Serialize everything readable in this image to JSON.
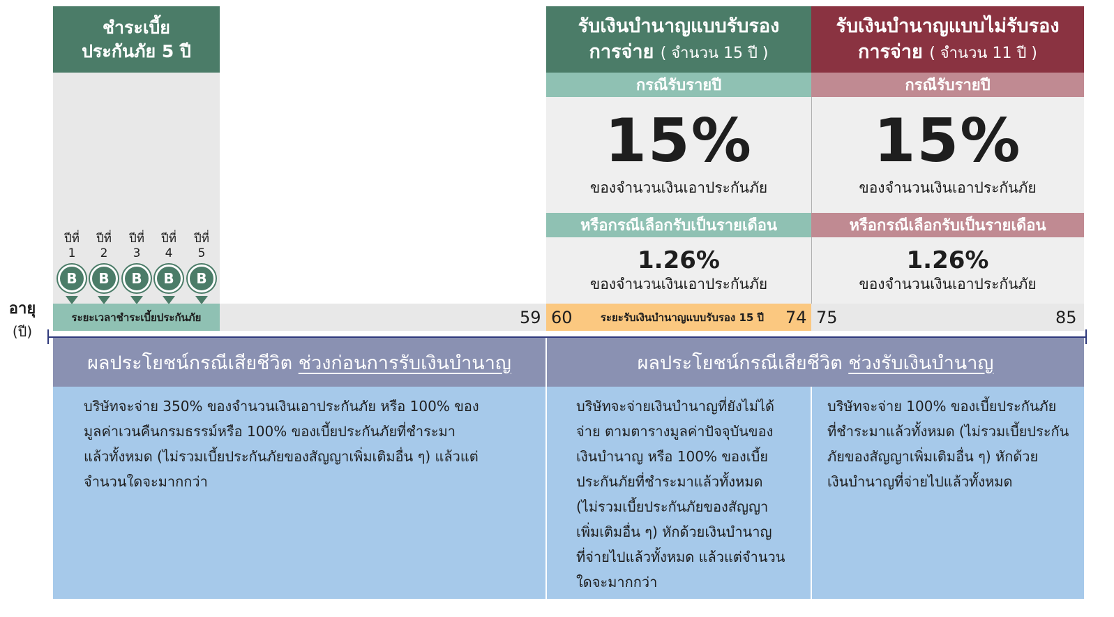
{
  "payment_header": {
    "line1": "ชำระเบี้ย",
    "line2": "ประกันภัย 5 ปี"
  },
  "certified_header": {
    "line1": "รับเงินบำนาญแบบรับรอง",
    "line2_main": "การจ่าย",
    "line2_sub": "( จำนวน 15 ปี )"
  },
  "uncertified_header": {
    "line1": "รับเงินบำนาญแบบไม่รับรอง",
    "line2_main": "การจ่าย",
    "line2_sub": "( จำนวน 11 ปี )"
  },
  "payment_years": [
    {
      "label_top": "ปีที่",
      "label_num": "1",
      "badge": "B"
    },
    {
      "label_top": "ปีที่",
      "label_num": "2",
      "badge": "B"
    },
    {
      "label_top": "ปีที่",
      "label_num": "3",
      "badge": "B"
    },
    {
      "label_top": "ปีที่",
      "label_num": "4",
      "badge": "B"
    },
    {
      "label_top": "ปีที่",
      "label_num": "5",
      "badge": "B"
    }
  ],
  "certified_panel": {
    "yearly_label": "กรณีรับรายปี",
    "yearly_pct": "15%",
    "yearly_note": "ของจำนวนเงินเอาประกันภัย",
    "monthly_label": "หรือกรณีเลือกรับเป็นรายเดือน",
    "monthly_pct": "1.26%",
    "monthly_note": "ของจำนวนเงินเอาประกันภัย"
  },
  "uncertified_panel": {
    "yearly_label": "กรณีรับรายปี",
    "yearly_pct": "15%",
    "yearly_note": "ของจำนวนเงินเอาประกันภัย",
    "monthly_label": "หรือกรณีเลือกรับเป็นรายเดือน",
    "monthly_pct": "1.26%",
    "monthly_note": "ของจำนวนเงินเอาประกันภัย"
  },
  "timeline": {
    "axis_label": "อายุ",
    "axis_unit": "(ปี)",
    "payment_period_label": "ระยะเวลาชำระเบี้ยประกันภัย",
    "certified_period_label": "ระยะรับเงินบำนาญแบบรับรอง 15 ปี",
    "ages": {
      "a59": "59",
      "a60": "60",
      "a74": "74",
      "a75": "75",
      "a85": "85"
    }
  },
  "colors": {
    "green_dark": "#4b7c68",
    "green_light": "#8fc1b3",
    "maroon": "#8a3341",
    "rose": "#c08a92",
    "orange": "#fbc880",
    "navy_line": "#2f3a7c",
    "slate_band": "#8a91b2",
    "blue_body": "#a6c9ea"
  },
  "bottom": {
    "left_title_plain": "ผลประโยชน์กรณีเสียชีวิต",
    "left_title_underlined": "ช่วงก่อนการรับเงินบำนาญ",
    "right_title_plain": "ผลประโยชน์กรณีเสียชีวิต",
    "right_title_underlined": "ช่วงรับเงินบำนาญ",
    "left_text": [
      "บริษัทจะจ่าย 350% ของจำนวนเงินเอาประกันภัย หรือ 100% ของ",
      "มูลค่าเวนคืนกรมธรรม์หรือ 100% ของเบี้ยประกันภัยที่ชำระมา",
      "แล้วทั้งหมด  (ไม่รวมเบี้ยประกันภัยของสัญญาเพิ่มเติมอื่น ๆ) แล้วแต่",
      "จำนวนใดจะมากกว่า"
    ],
    "middle_text": [
      "บริษัทจะจ่ายเงินบำนาญที่ยังไม่ได้",
      "จ่าย ตามตารางมูลค่าปัจจุบันของ",
      "เงินบำนาญ หรือ 100% ของเบี้ย",
      "ประกันภัยที่ชำระมาแล้วทั้งหมด",
      "(ไม่รวมเบี้ยประกันภัยของสัญญา",
      "เพิ่มเติมอื่น ๆ) หักด้วยเงินบำนาญ",
      "ที่จ่ายไปแล้วทั้งหมด แล้วแต่จำนวน",
      "ใดจะมากกว่า"
    ],
    "right_text": [
      "บริษัทจะจ่าย 100% ของเบี้ยประกันภัย",
      "ที่ชำระมาแล้วทั้งหมด (ไม่รวมเบี้ยประกัน",
      "ภัยของสัญญาเพิ่มเติมอื่น ๆ) หักด้วย",
      "เงินบำนาญที่จ่ายไปแล้วทั้งหมด"
    ]
  }
}
